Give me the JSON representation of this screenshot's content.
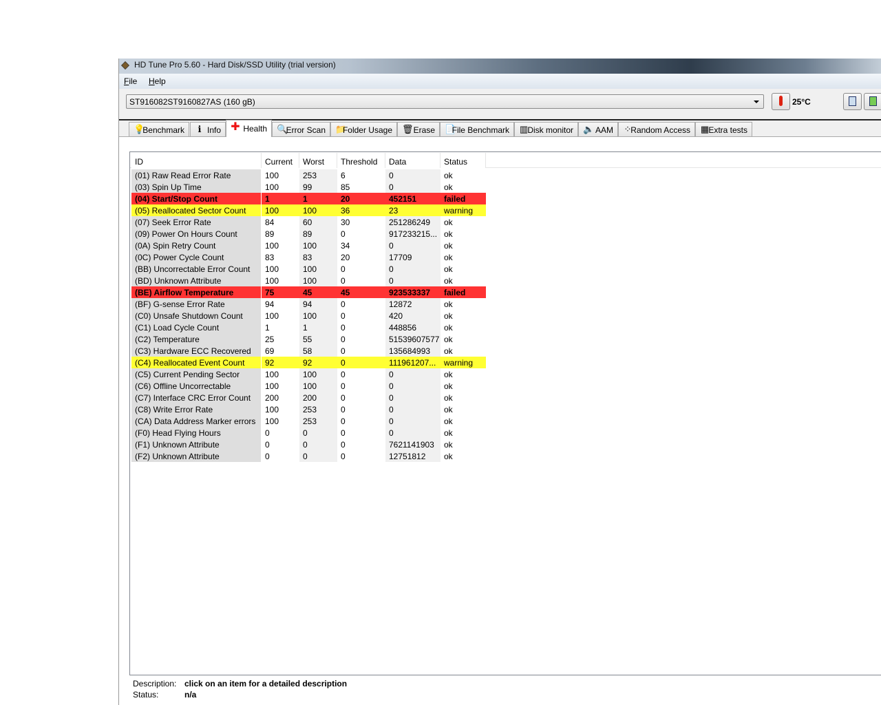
{
  "window": {
    "title": "HD Tune Pro 5.60 - Hard Disk/SSD Utility (trial version)"
  },
  "menu": [
    "File",
    "Help"
  ],
  "drive": {
    "selected": "ST916082ST9160827AS (160 gB)"
  },
  "temperature": "25°C",
  "tabs": [
    {
      "label": "Benchmark",
      "icon": "bulb-icon",
      "glyph": "💡"
    },
    {
      "label": "Info",
      "icon": "info-icon",
      "glyph": "ℹ"
    },
    {
      "label": "Health",
      "icon": "health-cross-icon",
      "glyph": "✚",
      "selected": true
    },
    {
      "label": "Error Scan",
      "icon": "magnifier-icon",
      "glyph": "🔍"
    },
    {
      "label": "Folder Usage",
      "icon": "folder-icon",
      "glyph": "📁"
    },
    {
      "label": "Erase",
      "icon": "trash-icon",
      "glyph": "🗑"
    },
    {
      "label": "File Benchmark",
      "icon": "file-benchmark-icon",
      "glyph": "📄"
    },
    {
      "label": "Disk monitor",
      "icon": "disk-monitor-icon",
      "glyph": "▥"
    },
    {
      "label": "AAM",
      "icon": "speaker-icon",
      "glyph": "🔈"
    },
    {
      "label": "Random Access",
      "icon": "random-access-icon",
      "glyph": "⁘"
    },
    {
      "label": "Extra tests",
      "icon": "extra-tests-icon",
      "glyph": "▦"
    }
  ],
  "table": {
    "columns": [
      "ID",
      "Current",
      "Worst",
      "Threshold",
      "Data",
      "Status"
    ],
    "rows": [
      [
        "(01) Raw Read Error Rate",
        "100",
        "253",
        "6",
        "0",
        "ok"
      ],
      [
        "(03) Spin Up Time",
        "100",
        "99",
        "85",
        "0",
        "ok"
      ],
      [
        "(04) Start/Stop Count",
        "1",
        "1",
        "20",
        "452151",
        "failed"
      ],
      [
        "(05) Reallocated Sector Count",
        "100",
        "100",
        "36",
        "23",
        "warning"
      ],
      [
        "(07) Seek Error Rate",
        "84",
        "60",
        "30",
        "251286249",
        "ok"
      ],
      [
        "(09) Power On Hours Count",
        "89",
        "89",
        "0",
        "917233215...",
        "ok"
      ],
      [
        "(0A) Spin Retry Count",
        "100",
        "100",
        "34",
        "0",
        "ok"
      ],
      [
        "(0C) Power Cycle Count",
        "83",
        "83",
        "20",
        "17709",
        "ok"
      ],
      [
        "(BB) Uncorrectable Error Count",
        "100",
        "100",
        "0",
        "0",
        "ok"
      ],
      [
        "(BD) Unknown Attribute",
        "100",
        "100",
        "0",
        "0",
        "ok"
      ],
      [
        "(BE) Airflow Temperature",
        "75",
        "45",
        "45",
        "923533337",
        "failed"
      ],
      [
        "(BF) G-sense Error Rate",
        "94",
        "94",
        "0",
        "12872",
        "ok"
      ],
      [
        "(C0) Unsafe Shutdown Count",
        "100",
        "100",
        "0",
        "420",
        "ok"
      ],
      [
        "(C1) Load Cycle Count",
        "1",
        "1",
        "0",
        "448856",
        "ok"
      ],
      [
        "(C2) Temperature",
        "25",
        "55",
        "0",
        "51539607577",
        "ok"
      ],
      [
        "(C3) Hardware ECC Recovered",
        "69",
        "58",
        "0",
        "135684993",
        "ok"
      ],
      [
        "(C4) Reallocated Event Count",
        "92",
        "92",
        "0",
        "111961207...",
        "warning"
      ],
      [
        "(C5) Current Pending Sector",
        "100",
        "100",
        "0",
        "0",
        "ok"
      ],
      [
        "(C6) Offline Uncorrectable",
        "100",
        "100",
        "0",
        "0",
        "ok"
      ],
      [
        "(C7) Interface CRC Error Count",
        "200",
        "200",
        "0",
        "0",
        "ok"
      ],
      [
        "(C8) Write Error Rate",
        "100",
        "253",
        "0",
        "0",
        "ok"
      ],
      [
        "(CA) Data Address Marker errors",
        "100",
        "253",
        "0",
        "0",
        "ok"
      ],
      [
        "(F0) Head Flying Hours",
        "0",
        "0",
        "0",
        "0",
        "ok"
      ],
      [
        "(F1) Unknown Attribute",
        "0",
        "0",
        "0",
        "7621141903",
        "ok"
      ],
      [
        "(F2) Unknown Attribute",
        "0",
        "0",
        "0",
        "12751812",
        "ok"
      ]
    ]
  },
  "description": {
    "label": "Description:",
    "value": "click on an item for a detailed description"
  },
  "status": {
    "label": "Status:",
    "value": "n/a"
  },
  "colors": {
    "failed": "#ff3333",
    "warning": "#ffff33"
  }
}
